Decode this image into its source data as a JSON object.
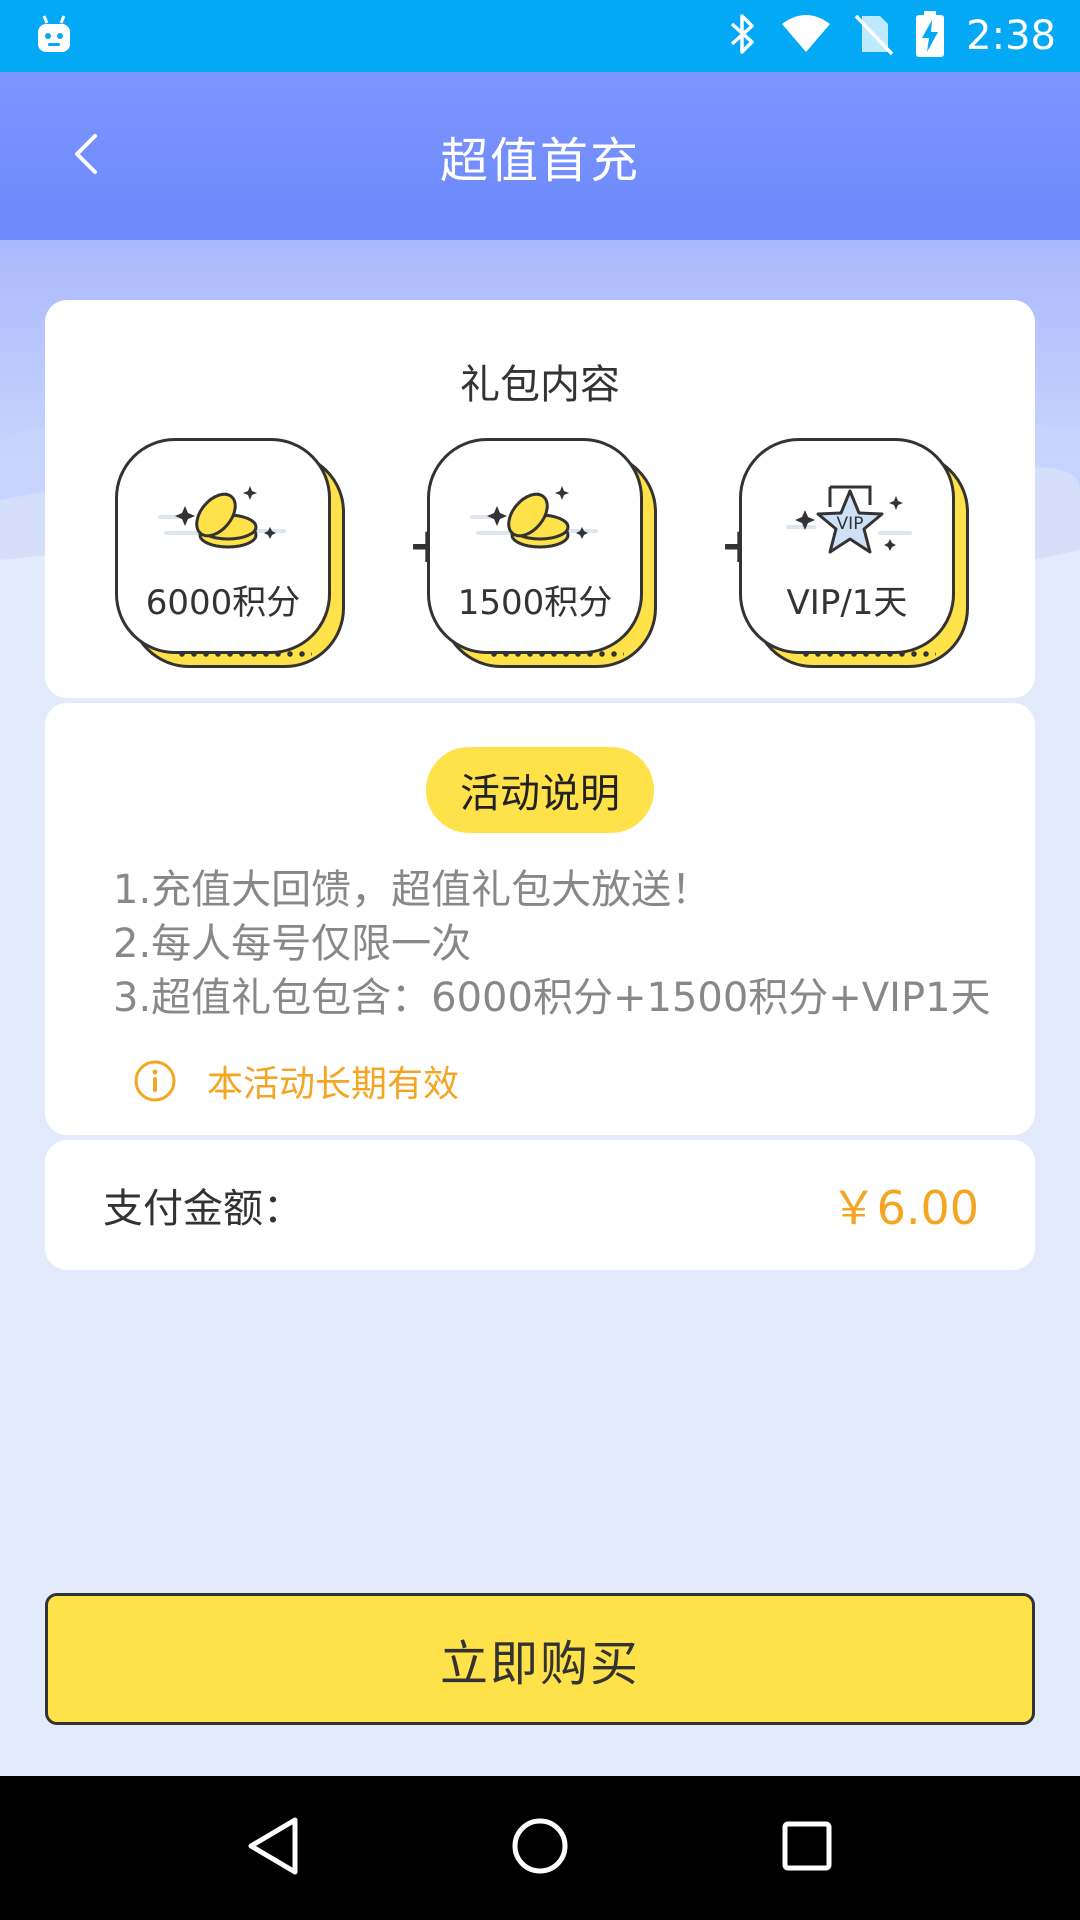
{
  "status_bar": {
    "time": "2:38",
    "icons": [
      "android-icon",
      "bluetooth-icon",
      "wifi-icon",
      "no-sim-icon",
      "battery-charging-icon"
    ]
  },
  "app_bar": {
    "title": "超值首充",
    "back_icon": "chevron-left-icon"
  },
  "gift_package": {
    "title": "礼包内容",
    "items": [
      {
        "label": "6000积分",
        "icon": "coins-icon"
      },
      {
        "label": "1500积分",
        "icon": "coins-icon"
      },
      {
        "label": "VIP/1天",
        "icon": "vip-star-icon",
        "icon_text": "VIP"
      }
    ],
    "separator": "+"
  },
  "rules": {
    "title": "活动说明",
    "lines": [
      "1.充值大回馈，超值礼包大放送！",
      "2.每人每号仅限一次",
      "3.超值礼包包含：6000积分+1500积分+VIP1天"
    ],
    "notice": "本活动长期有效",
    "notice_icon": "info-icon"
  },
  "payment": {
    "label": "支付金额：",
    "amount": "￥6.00"
  },
  "buy_button": {
    "label": "立即购买"
  },
  "nav_bar": {
    "icons": [
      "back-triangle-icon",
      "home-circle-icon",
      "recents-square-icon"
    ]
  },
  "colors": {
    "status_bar": "#03a9f4",
    "app_bar": "#6c88fb",
    "accent_yellow": "#ffe14a",
    "accent_orange": "#f4a623",
    "page_bg": "#e2eafc"
  }
}
